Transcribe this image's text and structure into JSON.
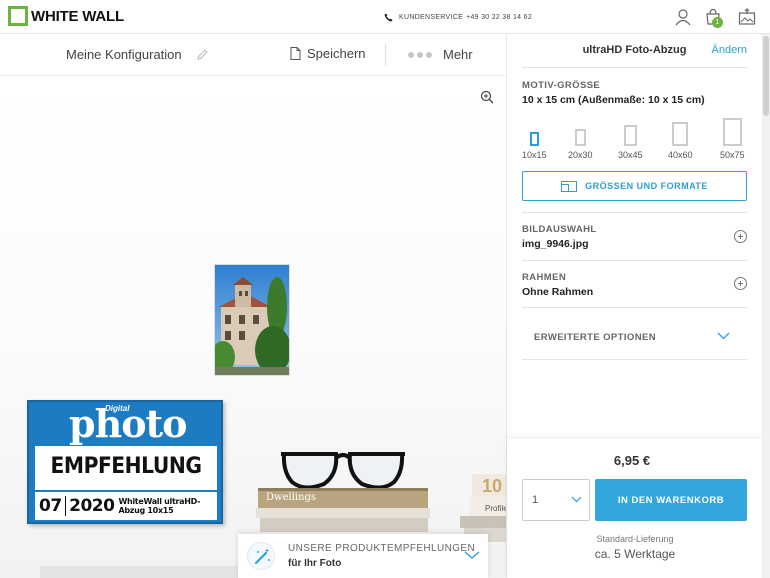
{
  "header": {
    "logo_text": "WHITE WALL",
    "service_label": "KUNDENSERVICE",
    "service_phone": "+49 30 22 38 14 62",
    "cart_count": "1",
    "brand_color": "#6cb33f"
  },
  "toolbar": {
    "config_label": "Meine Konfiguration",
    "save_label": "Speichern",
    "more_label": "Mehr"
  },
  "award": {
    "small_text": "Digital",
    "title": "photo",
    "headline": "EMPFEHLUNG",
    "issue": "07",
    "year": "2020",
    "product": "WhiteWall ultraHD-Abzug 10x15"
  },
  "scene": {
    "book1": "Dwellings",
    "book2_number": "10",
    "book2_label": "Profile"
  },
  "recommendation": {
    "line1": "UNSERE PRODUKTEMPFEHLUNGEN",
    "line2": "für Ihr Foto"
  },
  "panel": {
    "product_title": "ultraHD Foto-Abzug",
    "change_label": "Ändern",
    "size_section_label": "MOTIV-GRÖSSE",
    "size_value": "10 x 15 cm (Außenmaße: 10 x 15 cm)",
    "size_options": [
      "10x15",
      "20x30",
      "30x45",
      "40x60",
      "50x75"
    ],
    "selected_size": "10x15",
    "formats_button": "GRÖSSEN UND FORMATE",
    "image_label": "BILDAUSWAHL",
    "image_value": "img_9946.jpg",
    "frame_label": "RAHMEN",
    "frame_value": "Ohne Rahmen",
    "extended_label": "ERWEITERTE OPTIONEN",
    "price": "6,95 €",
    "quantity": "1",
    "cart_button": "IN DEN WARENKORB",
    "delivery_type": "Standard-Lieferung",
    "delivery_time": "ca. 5 Werktage",
    "accent_color": "#33a6dc"
  }
}
